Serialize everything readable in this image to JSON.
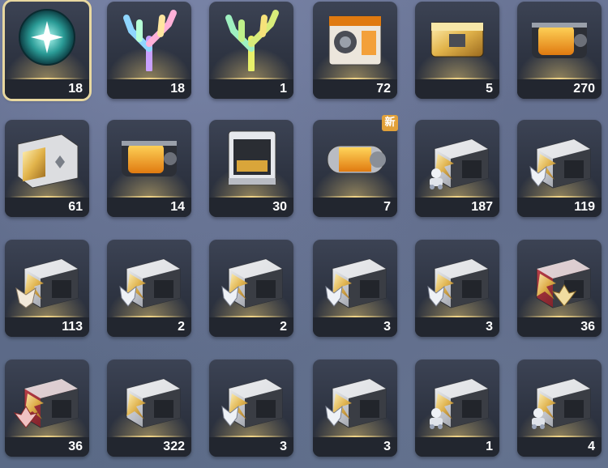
{
  "items": [
    {
      "icon": "crystal-orb-icon",
      "count": "18",
      "selected": true
    },
    {
      "icon": "rainbow-coral-icon",
      "count": "18"
    },
    {
      "icon": "gold-coral-icon",
      "count": "1"
    },
    {
      "icon": "orange-safe-box-icon",
      "count": "72"
    },
    {
      "icon": "small-gold-chest-icon",
      "count": "5"
    },
    {
      "icon": "orange-capsule-chest-icon",
      "count": "270"
    },
    {
      "icon": "silver-gold-chest-icon",
      "count": "61"
    },
    {
      "icon": "orange-capsule-chest-icon",
      "count": "14"
    },
    {
      "icon": "printer-machine-icon",
      "count": "30"
    },
    {
      "icon": "gold-capsule-icon",
      "count": "7",
      "badge": "新"
    },
    {
      "icon": "steel-crate-knight-icon",
      "count": "187"
    },
    {
      "icon": "steel-crate-wolf-icon",
      "count": "119"
    },
    {
      "icon": "steel-crate-fox-icon",
      "count": "113"
    },
    {
      "icon": "steel-crate-wolf-icon",
      "count": "2"
    },
    {
      "icon": "steel-crate-wolf-icon",
      "count": "2"
    },
    {
      "icon": "steel-crate-wolf-icon",
      "count": "3"
    },
    {
      "icon": "steel-crate-wolf-icon",
      "count": "3"
    },
    {
      "icon": "red-crate-gold-emblem-icon",
      "count": "36"
    },
    {
      "icon": "red-crate-red-emblem-icon",
      "count": "36"
    },
    {
      "icon": "steel-crate-plain-icon",
      "count": "322"
    },
    {
      "icon": "steel-crate-wolf-icon",
      "count": "3"
    },
    {
      "icon": "steel-crate-wolf-icon",
      "count": "3"
    },
    {
      "icon": "steel-crate-knight-icon",
      "count": "1"
    },
    {
      "icon": "steel-crate-knight-icon",
      "count": "4"
    }
  ]
}
